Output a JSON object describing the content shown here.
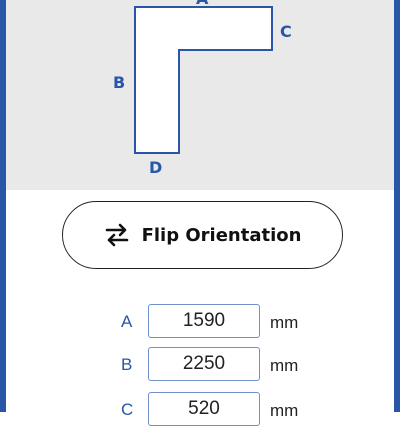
{
  "preview": {
    "label_a": "A",
    "label_b": "B",
    "label_c": "C",
    "label_d": "D"
  },
  "flip_button": {
    "label": "Flip Orientation",
    "icon": "swap-arrows-icon"
  },
  "dimensions": [
    {
      "letter": "A",
      "value": "1590",
      "unit": "mm"
    },
    {
      "letter": "B",
      "value": "2250",
      "unit": "mm"
    },
    {
      "letter": "C",
      "value": "520",
      "unit": "mm"
    }
  ],
  "colors": {
    "accent": "#2a56a8",
    "preview_bg": "#e9e9ea"
  }
}
